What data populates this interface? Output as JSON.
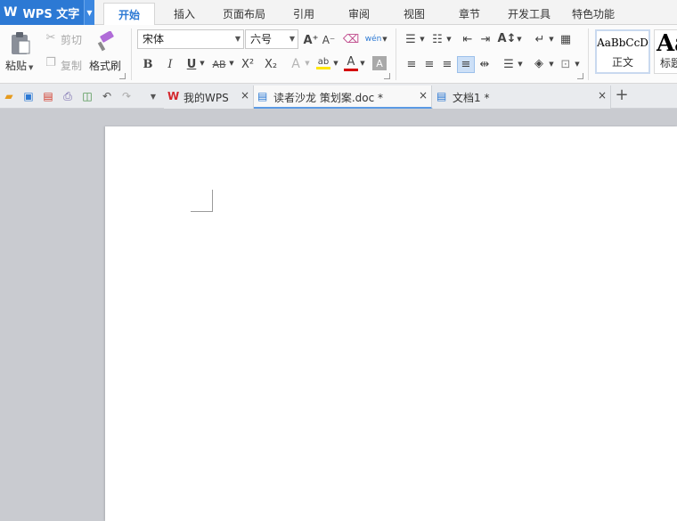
{
  "app": {
    "logo": "W",
    "name": "WPS 文字"
  },
  "menu": {
    "tabs": [
      {
        "label": "开始",
        "active": true
      },
      {
        "label": "插入"
      },
      {
        "label": "页面布局"
      },
      {
        "label": "引用"
      },
      {
        "label": "审阅"
      },
      {
        "label": "视图"
      },
      {
        "label": "章节"
      },
      {
        "label": "开发工具"
      },
      {
        "label": "特色功能"
      }
    ]
  },
  "ribbon": {
    "clipboard": {
      "paste": "粘贴",
      "cut": "剪切",
      "copy": "复制",
      "format_painter": "格式刷"
    },
    "font": {
      "family": "宋体",
      "size": "六号",
      "grow_font": "A⁺",
      "shrink_font": "A⁻",
      "bold": "B",
      "italic": "I",
      "underline": "U",
      "strikethrough": "AB",
      "superscript": "X²",
      "subscript": "X₂",
      "text_effect": "A",
      "highlight": "ab",
      "font_color": "A",
      "char_shading": "A"
    },
    "styles": {
      "sample_1": "AaBbCcD",
      "name_1": "正文",
      "sample_2": "Aa",
      "name_2": "标题"
    }
  },
  "document_tabs": [
    {
      "label": "我的WPS",
      "icon": "wps-home-icon"
    },
    {
      "label": "读者沙龙 策划案.doc *",
      "icon": "doc-file-icon",
      "active": true
    },
    {
      "label": "文档1 *",
      "icon": "doc-file-icon"
    }
  ],
  "colors": {
    "accent": "#2c79d4",
    "font_color_bar": "#d40000",
    "highlight_bar": "#ffe600",
    "workspace": "#c9cbd0"
  }
}
